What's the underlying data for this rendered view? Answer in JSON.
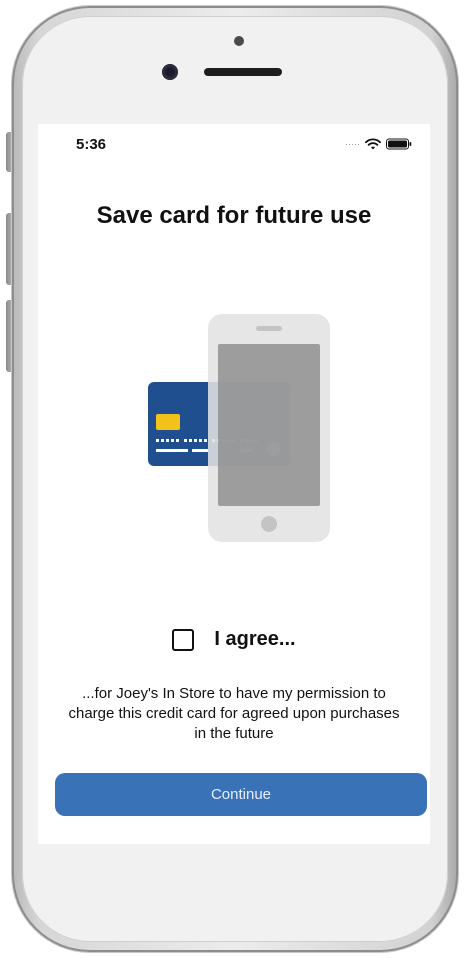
{
  "status_bar": {
    "time": "5:36",
    "signal_icon": "signal-dots-icon",
    "wifi_icon": "wifi-icon",
    "battery_icon": "battery-icon"
  },
  "page": {
    "title": "Save card for future use"
  },
  "illustration": {
    "card_icon": "credit-card-icon",
    "phone_icon": "smartphone-icon",
    "card_color": "#1f4f8e",
    "chip_color": "#f2c21b",
    "phone_screen_color": "#8f8f8f"
  },
  "consent": {
    "checkbox_checked": false,
    "agree_label": "I agree...",
    "permission_text": "...for Joey's In Store to have my permission to charge this credit card for agreed upon purchases in the future"
  },
  "actions": {
    "continue_label": "Continue",
    "accent_color": "#3a72b8"
  }
}
